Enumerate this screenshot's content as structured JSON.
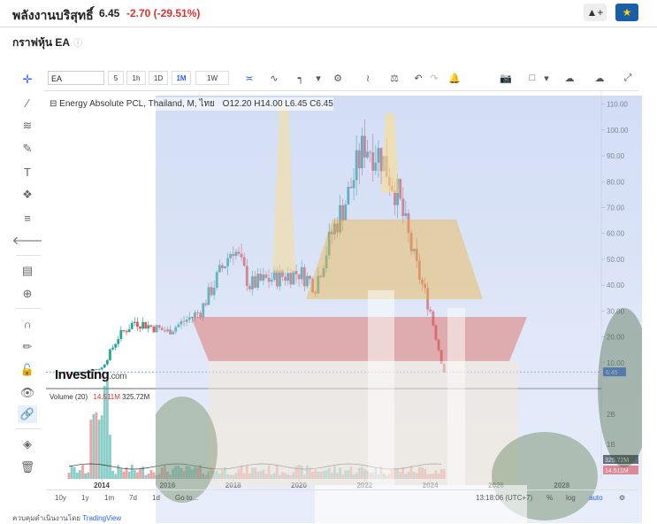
{
  "header": {
    "name": "พลังงานบริสุทธิ์",
    "price": "6.45",
    "change": "-2.70 (-29.51%)"
  },
  "section": {
    "title": "กราฟหุ้น EA",
    "info_icon": "info-icon"
  },
  "toolbar": {
    "symbol": "EA",
    "timeframes": [
      "5",
      "1h",
      "1D",
      "1M",
      "1W"
    ],
    "active_timeframe": "1M"
  },
  "legend": {
    "title": "Energy Absolute PCL, Thailand, M, ไทย",
    "open": "O12.20",
    "high": "H14.00",
    "low": "L6.45",
    "close": "C6.45"
  },
  "volume": {
    "label": "Volume (20)",
    "v1": "14.511M",
    "v2": "325.72M",
    "axis": [
      "2B",
      "1B"
    ]
  },
  "price_axis": [
    "110.00",
    "100.00",
    "90.00",
    "80.00",
    "70.00",
    "60.00",
    "50.00",
    "40.00",
    "30.00",
    "20.00",
    "10.00"
  ],
  "price_tag": "6.45",
  "vol_tags": [
    "325.72M",
    "14.511M"
  ],
  "years": [
    "2014",
    "2016",
    "2018",
    "2020",
    "2022",
    "2024",
    "2026",
    "2028"
  ],
  "bottom": {
    "ranges": [
      "10y",
      "1y",
      "1m",
      "7d",
      "1d",
      "Go to..."
    ],
    "time": "13:18:06 (UTC+7)",
    "pct": "%",
    "log": "log",
    "auto": "auto"
  },
  "watermark": {
    "brand": "Investing",
    "suffix": ".com"
  },
  "footer": {
    "prefix": "ควบคุมดำเนินงานโดย",
    "provider": "TradingView"
  },
  "colors": {
    "up": "#26a69a",
    "down": "#ef5350",
    "accent": "#2962ff",
    "neg": "#e0312b"
  },
  "chart_data": {
    "type": "candlestick",
    "period": "monthly",
    "x_range": [
      "2013",
      "2024"
    ],
    "ylim": [
      0,
      115
    ],
    "series_close_samples": [
      {
        "year": 2013.0,
        "close": 5.5
      },
      {
        "year": 2014.0,
        "close": 8.0
      },
      {
        "year": 2014.5,
        "close": 20.0
      },
      {
        "year": 2015.0,
        "close": 26.0
      },
      {
        "year": 2016.0,
        "close": 22.0
      },
      {
        "year": 2017.0,
        "close": 30.0
      },
      {
        "year": 2018.0,
        "close": 55.0
      },
      {
        "year": 2018.5,
        "close": 40.0
      },
      {
        "year": 2019.0,
        "close": 42.0
      },
      {
        "year": 2020.0,
        "close": 45.0
      },
      {
        "year": 2020.5,
        "close": 40.0
      },
      {
        "year": 2021.0,
        "close": 60.0
      },
      {
        "year": 2021.5,
        "close": 75.0
      },
      {
        "year": 2022.0,
        "close": 95.0
      },
      {
        "year": 2022.5,
        "close": 90.0
      },
      {
        "year": 2023.0,
        "close": 75.0
      },
      {
        "year": 2023.5,
        "close": 50.0
      },
      {
        "year": 2024.0,
        "close": 30.0
      },
      {
        "year": 2024.4,
        "close": 6.45
      }
    ]
  }
}
